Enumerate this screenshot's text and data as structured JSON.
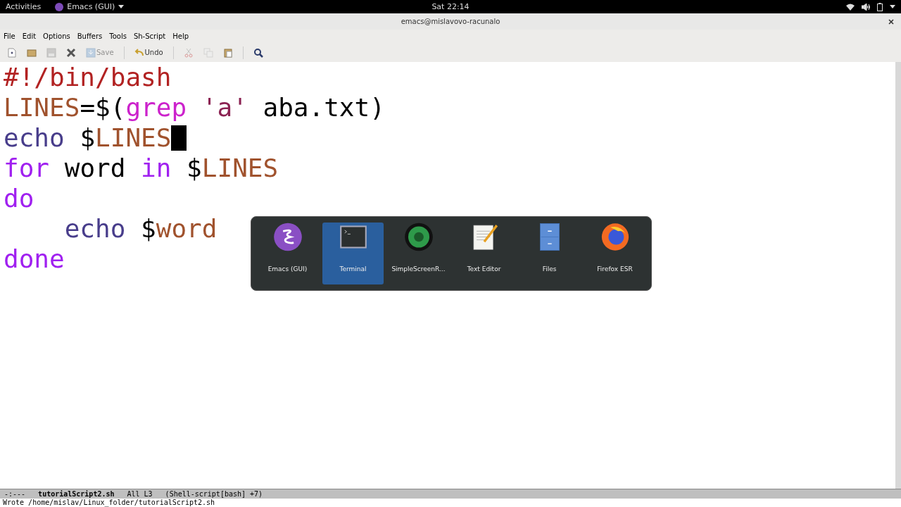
{
  "top_bar": {
    "activities": "Activities",
    "app_menu": "Emacs (GUI)",
    "clock": "Sat 22:14"
  },
  "window": {
    "title": "emacs@mislavovo-racunalo"
  },
  "menu": [
    "File",
    "Edit",
    "Options",
    "Buffers",
    "Tools",
    "Sh-Script",
    "Help"
  ],
  "toolbar": [
    {
      "kind": "new-file",
      "disabled": false
    },
    {
      "kind": "folder",
      "disabled": false
    },
    {
      "kind": "disk",
      "disabled": true
    },
    {
      "kind": "close",
      "disabled": false
    },
    {
      "kind": "save",
      "label": "Save",
      "disabled": true
    },
    {
      "kind": "undo",
      "label": "Undo",
      "disabled": false
    },
    {
      "kind": "cut",
      "disabled": true
    },
    {
      "kind": "copy",
      "disabled": true
    },
    {
      "kind": "paste",
      "disabled": false
    },
    {
      "kind": "search",
      "disabled": false
    }
  ],
  "editor": {
    "lines": [
      {
        "cursor": false,
        "tokens": [
          {
            "kind": "comment",
            "text": "#!/bin/bash"
          }
        ]
      },
      {
        "cursor": false,
        "tokens": [
          {
            "kind": "variable",
            "text": "LINES"
          },
          {
            "kind": "plain",
            "text": "=$("
          },
          {
            "kind": "command",
            "text": "grep "
          },
          {
            "kind": "string",
            "text": "'a'"
          },
          {
            "kind": "plain",
            "text": " aba.txt)"
          }
        ]
      },
      {
        "cursor": true,
        "tokens": [
          {
            "kind": "builtin",
            "text": "echo"
          },
          {
            "kind": "plain",
            "text": " $"
          },
          {
            "kind": "variable",
            "text": "LINES"
          }
        ]
      },
      {
        "cursor": false,
        "tokens": [
          {
            "kind": "keyword",
            "text": "for"
          },
          {
            "kind": "plain",
            "text": " word "
          },
          {
            "kind": "keyword",
            "text": "in"
          },
          {
            "kind": "plain",
            "text": " $"
          },
          {
            "kind": "variable",
            "text": "LINES"
          }
        ]
      },
      {
        "cursor": false,
        "tokens": [
          {
            "kind": "keyword",
            "text": "do"
          }
        ]
      },
      {
        "cursor": false,
        "tokens": [
          {
            "kind": "builtin",
            "text": "    echo"
          },
          {
            "kind": "plain",
            "text": " $"
          },
          {
            "kind": "variable",
            "text": "word"
          }
        ]
      },
      {
        "cursor": false,
        "tokens": [
          {
            "kind": "keyword",
            "text": "done"
          }
        ]
      }
    ]
  },
  "switcher": [
    {
      "kind": "emacs",
      "label": "Emacs (GUI)",
      "selected": false
    },
    {
      "kind": "terminal",
      "label": "Terminal",
      "selected": true
    },
    {
      "kind": "camera",
      "label": "SimpleScreenR...",
      "selected": false
    },
    {
      "kind": "text-editor",
      "label": "Text Editor",
      "selected": false
    },
    {
      "kind": "files",
      "label": "Files",
      "selected": false
    },
    {
      "kind": "firefox",
      "label": "Firefox ESR",
      "selected": false
    }
  ],
  "mode_line": {
    "state": "-:---",
    "buffer": "tutorialScript2.sh",
    "position": "All L3",
    "mode": "(Shell-script[bash] +7)"
  },
  "echo_area": "Wrote /home/mislav/Linux_folder/tutorialScript2.sh"
}
